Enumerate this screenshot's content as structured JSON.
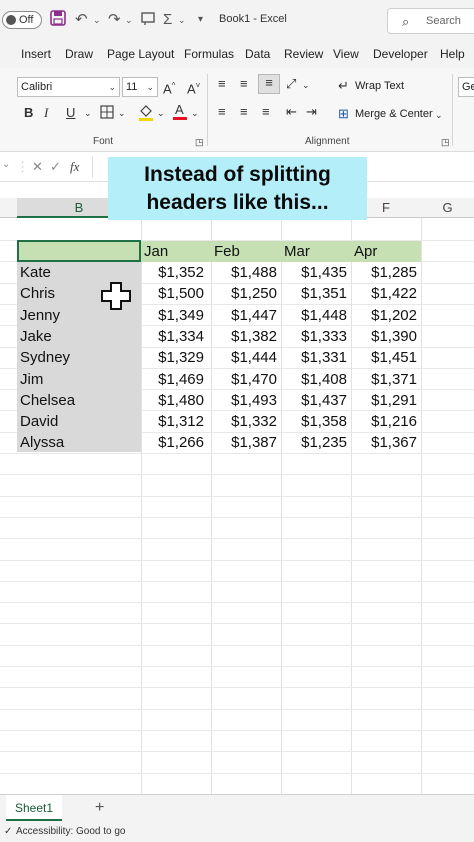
{
  "titlebar": {
    "autosave": "Off",
    "title": "Book1 - Excel",
    "search_placeholder": "Search"
  },
  "menu": {
    "tabs": [
      "Insert",
      "Draw",
      "Page Layout",
      "Formulas",
      "Data",
      "Review",
      "View",
      "Developer",
      "Help"
    ]
  },
  "ribbon": {
    "font_name": "Calibri",
    "font_size": "11",
    "bold": "B",
    "italic": "I",
    "underline": "U",
    "grow_font": "A^",
    "shrink_font": "A˅",
    "wrap_text": "Wrap Text",
    "merge_center": "Merge & Center",
    "number_format": "Ge",
    "group_font": "Font",
    "group_alignment": "Alignment"
  },
  "formula": {
    "fx": "fx"
  },
  "columns": {
    "b": "B",
    "f": "F",
    "g": "G"
  },
  "overlay": {
    "line1": "Instead of splitting",
    "line2": "headers like this..."
  },
  "table": {
    "months": [
      "Jan",
      "Feb",
      "Mar",
      "Apr"
    ],
    "rows": [
      {
        "name": "Kate",
        "values": [
          "$1,352",
          "$1,488",
          "$1,435",
          "$1,285"
        ]
      },
      {
        "name": "Chris",
        "values": [
          "$1,500",
          "$1,250",
          "$1,351",
          "$1,422"
        ]
      },
      {
        "name": "Jenny",
        "values": [
          "$1,349",
          "$1,447",
          "$1,448",
          "$1,202"
        ]
      },
      {
        "name": "Jake",
        "values": [
          "$1,334",
          "$1,382",
          "$1,333",
          "$1,390"
        ]
      },
      {
        "name": "Sydney",
        "values": [
          "$1,329",
          "$1,444",
          "$1,331",
          "$1,451"
        ]
      },
      {
        "name": "Jim",
        "values": [
          "$1,469",
          "$1,470",
          "$1,408",
          "$1,371"
        ]
      },
      {
        "name": "Chelsea",
        "values": [
          "$1,480",
          "$1,493",
          "$1,437",
          "$1,291"
        ]
      },
      {
        "name": "David",
        "values": [
          "$1,312",
          "$1,332",
          "$1,358",
          "$1,216"
        ]
      },
      {
        "name": "Alyssa",
        "values": [
          "$1,266",
          "$1,387",
          "$1,235",
          "$1,367"
        ]
      }
    ]
  },
  "sheets": {
    "active": "Sheet1",
    "add": "+"
  },
  "status": {
    "accessibility": "Accessibility: Good to go"
  },
  "colors": {
    "accent": "#1f7145",
    "header_fill": "#c6e0b4",
    "name_fill": "#d9d9d9",
    "overlay": "#b3eef9"
  }
}
